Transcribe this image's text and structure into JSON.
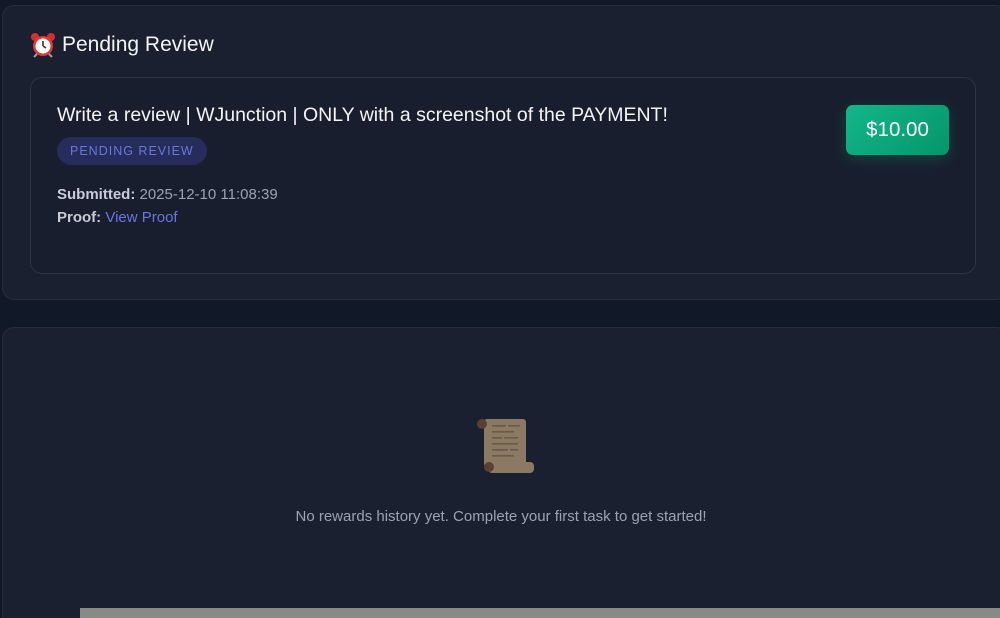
{
  "pending_section": {
    "icon": "alarm-clock-icon",
    "title": "Pending Review",
    "task": {
      "title": "Write a review | WJunction | ONLY with a screenshot of the PAYMENT!",
      "status_badge": "PENDING REVIEW",
      "submitted_label": "Submitted:",
      "submitted_value": "2025-12-10 11:08:39",
      "proof_label": "Proof:",
      "proof_link": "View Proof",
      "reward": "$10.00"
    }
  },
  "history_section": {
    "icon": "scroll-icon",
    "empty_message": "No rewards history yet. Complete your first task to get started!"
  },
  "colors": {
    "page_bg": "#111827",
    "card_bg": "#1a2030",
    "badge_bg": "#272d5a",
    "badge_text": "#6c75de",
    "reward_bg": "#0ea576",
    "link": "#6c75de"
  }
}
